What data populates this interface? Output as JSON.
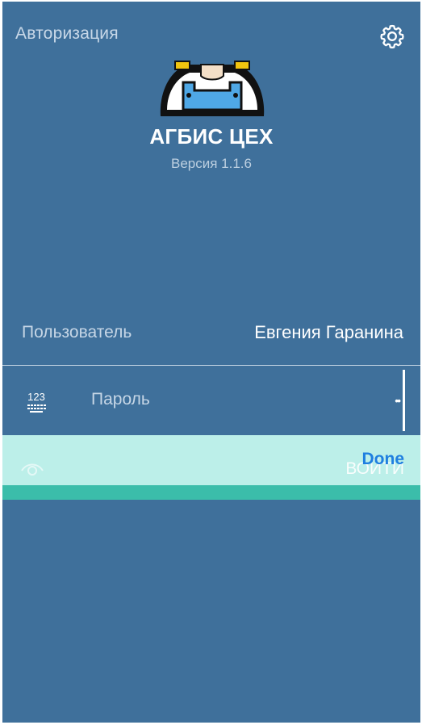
{
  "header": {
    "title": "Авторизация",
    "settings_icon": "gear-icon"
  },
  "app": {
    "name": "АГБИС ЦЕХ",
    "version": "Версия 1.1.6"
  },
  "form": {
    "user_label": "Пользователь",
    "user_value": "Евгения Гаранина",
    "password_label": "Пароль",
    "password_value": "••",
    "keyboard_icon": "numeric-keyboard-icon"
  },
  "keyboard_accessory": {
    "done_label": "Done",
    "login_label": "ВОЙТИ",
    "eye_icon": "eye-icon"
  },
  "colors": {
    "background": "#3f709b",
    "accessory": "#bcefe9",
    "accent_strip": "#3bbdaa",
    "done": "#1f7fe0"
  }
}
